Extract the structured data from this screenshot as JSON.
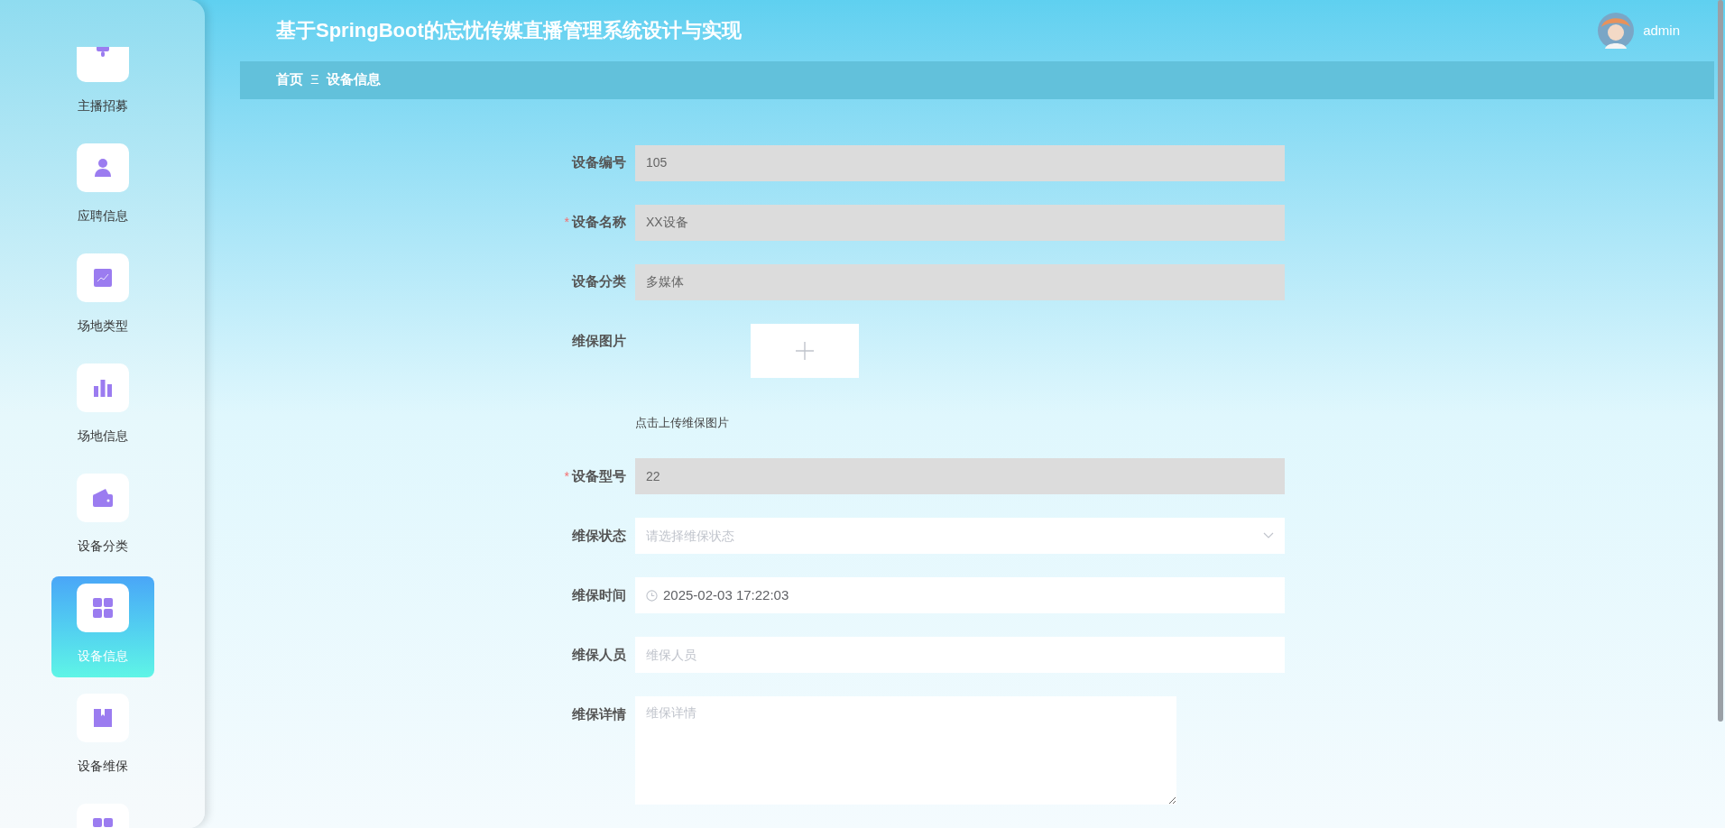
{
  "sidebar": {
    "items": [
      {
        "label": "主播招募",
        "selected": false
      },
      {
        "label": "应聘信息",
        "selected": false
      },
      {
        "label": "场地类型",
        "selected": false
      },
      {
        "label": "场地信息",
        "selected": false
      },
      {
        "label": "设备分类",
        "selected": false
      },
      {
        "label": "设备信息",
        "selected": true
      },
      {
        "label": "设备维保",
        "selected": false
      },
      {
        "selected": false
      }
    ]
  },
  "header": {
    "title": "基于SpringBoot的忘忧传媒直播管理系统设计与实现",
    "user": "admin"
  },
  "breadcrumb": {
    "items": [
      "首页",
      "设备信息"
    ],
    "separator": "Ξ"
  },
  "form": {
    "fields": [
      {
        "kind": "text",
        "label": "设备编号",
        "disabled": true,
        "value": "105"
      },
      {
        "kind": "text",
        "label": "设备名称",
        "required_mark": "*",
        "disabled": true,
        "value": "XX设备"
      },
      {
        "kind": "text",
        "label": "设备分类",
        "disabled": true,
        "value": "多媒体"
      },
      {
        "kind": "upload",
        "label": "维保图片",
        "hint": "点击上传维保图片"
      },
      {
        "kind": "text",
        "label": "设备型号",
        "required_mark": "*",
        "disabled": true,
        "value": "22"
      },
      {
        "kind": "select",
        "label": "维保状态",
        "placeholder": "请选择维保状态"
      },
      {
        "kind": "datetime",
        "label": "维保时间",
        "value": "2025-02-03 17:22:03"
      },
      {
        "kind": "text",
        "label": "维保人员",
        "disabled": false,
        "placeholder": "维保人员"
      },
      {
        "kind": "textarea",
        "label": "维保详情",
        "placeholder": "维保详情"
      }
    ]
  }
}
